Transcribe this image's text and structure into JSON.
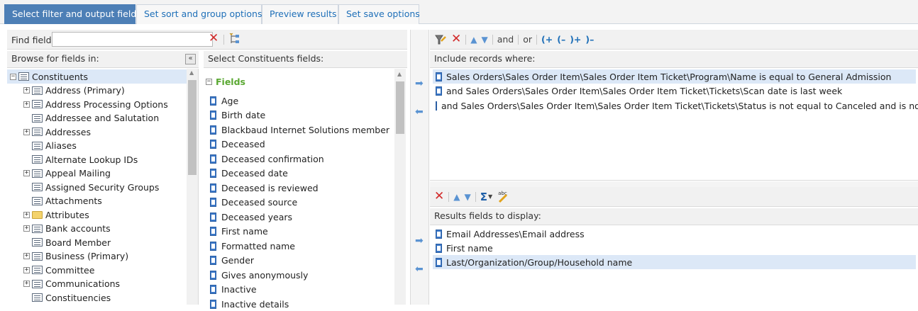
{
  "tabs": [
    {
      "label": "Select filter and output fields",
      "active": true
    },
    {
      "label": "Set sort and group options",
      "active": false
    },
    {
      "label": "Preview results",
      "active": false
    },
    {
      "label": "Set save options",
      "active": false
    }
  ],
  "find": {
    "label": "Find field:",
    "value": ""
  },
  "browse": {
    "header": "Browse for fields in:"
  },
  "tree": [
    {
      "label": "Constituents",
      "expander": "minus",
      "icon": "table",
      "indent": 0,
      "selected": true
    },
    {
      "label": "Address (Primary)",
      "expander": "plus",
      "icon": "table",
      "indent": 1
    },
    {
      "label": "Address Processing Options",
      "expander": "plus",
      "icon": "table",
      "indent": 1
    },
    {
      "label": "Addressee and Salutation",
      "expander": "none",
      "icon": "table",
      "indent": 1
    },
    {
      "label": "Addresses",
      "expander": "plus",
      "icon": "table",
      "indent": 1
    },
    {
      "label": "Aliases",
      "expander": "none",
      "icon": "table",
      "indent": 1
    },
    {
      "label": "Alternate Lookup IDs",
      "expander": "none",
      "icon": "table",
      "indent": 1
    },
    {
      "label": "Appeal Mailing",
      "expander": "plus",
      "icon": "table",
      "indent": 1
    },
    {
      "label": "Assigned Security Groups",
      "expander": "none",
      "icon": "table",
      "indent": 1
    },
    {
      "label": "Attachments",
      "expander": "none",
      "icon": "table",
      "indent": 1
    },
    {
      "label": "Attributes",
      "expander": "plus",
      "icon": "folder",
      "indent": 1
    },
    {
      "label": "Bank accounts",
      "expander": "plus",
      "icon": "table",
      "indent": 1
    },
    {
      "label": "Board Member",
      "expander": "none",
      "icon": "table",
      "indent": 1
    },
    {
      "label": "Business (Primary)",
      "expander": "plus",
      "icon": "table",
      "indent": 1
    },
    {
      "label": "Committee",
      "expander": "plus",
      "icon": "table",
      "indent": 1
    },
    {
      "label": "Communications",
      "expander": "plus",
      "icon": "table",
      "indent": 1
    },
    {
      "label": "Constituencies",
      "expander": "none",
      "icon": "table",
      "indent": 1
    }
  ],
  "fields_panel": {
    "header": "Select Constituents fields:",
    "group_label": "Fields"
  },
  "fields": [
    "Age",
    "Birth date",
    "Blackbaud Internet Solutions member",
    "Deceased",
    "Deceased confirmation",
    "Deceased date",
    "Deceased is reviewed",
    "Deceased source",
    "Deceased years",
    "First name",
    "Formatted name",
    "Gender",
    "Gives anonymously",
    "Inactive",
    "Inactive details"
  ],
  "filter_toolbar": {
    "and_label": "and",
    "or_label": "or",
    "open_paren": "(+",
    "open_paren_minus": "(–",
    "close_paren": ")+",
    "close_paren_minus": ")–"
  },
  "include": {
    "header": "Include records where:",
    "conditions": [
      {
        "text": "Sales Orders\\Sales Order Item\\Sales Order Item Ticket\\Program\\Name is equal to General Admission",
        "selected": true
      },
      {
        "text": "and Sales Orders\\Sales Order Item\\Sales Order Item Ticket\\Tickets\\Scan date is last week",
        "selected": false
      },
      {
        "text": "and Sales Orders\\Sales Order Item\\Sales Order Item Ticket\\Tickets\\Status is not equal to Canceled and is not blank",
        "selected": false
      }
    ]
  },
  "results": {
    "header": "Results fields to display:",
    "sigma_label": "Σ",
    "abc_label": "abc",
    "fields": [
      {
        "text": "Email Addresses\\Email address",
        "selected": false
      },
      {
        "text": "First name",
        "selected": false
      },
      {
        "text": "Last/Organization/Group/Household name",
        "selected": true
      }
    ]
  },
  "colors": {
    "accent": "#4d7fb6",
    "link": "#1e6fb8",
    "selection": "#dce8f7",
    "delete": "#d22b2b",
    "group_green": "#5aa832"
  }
}
